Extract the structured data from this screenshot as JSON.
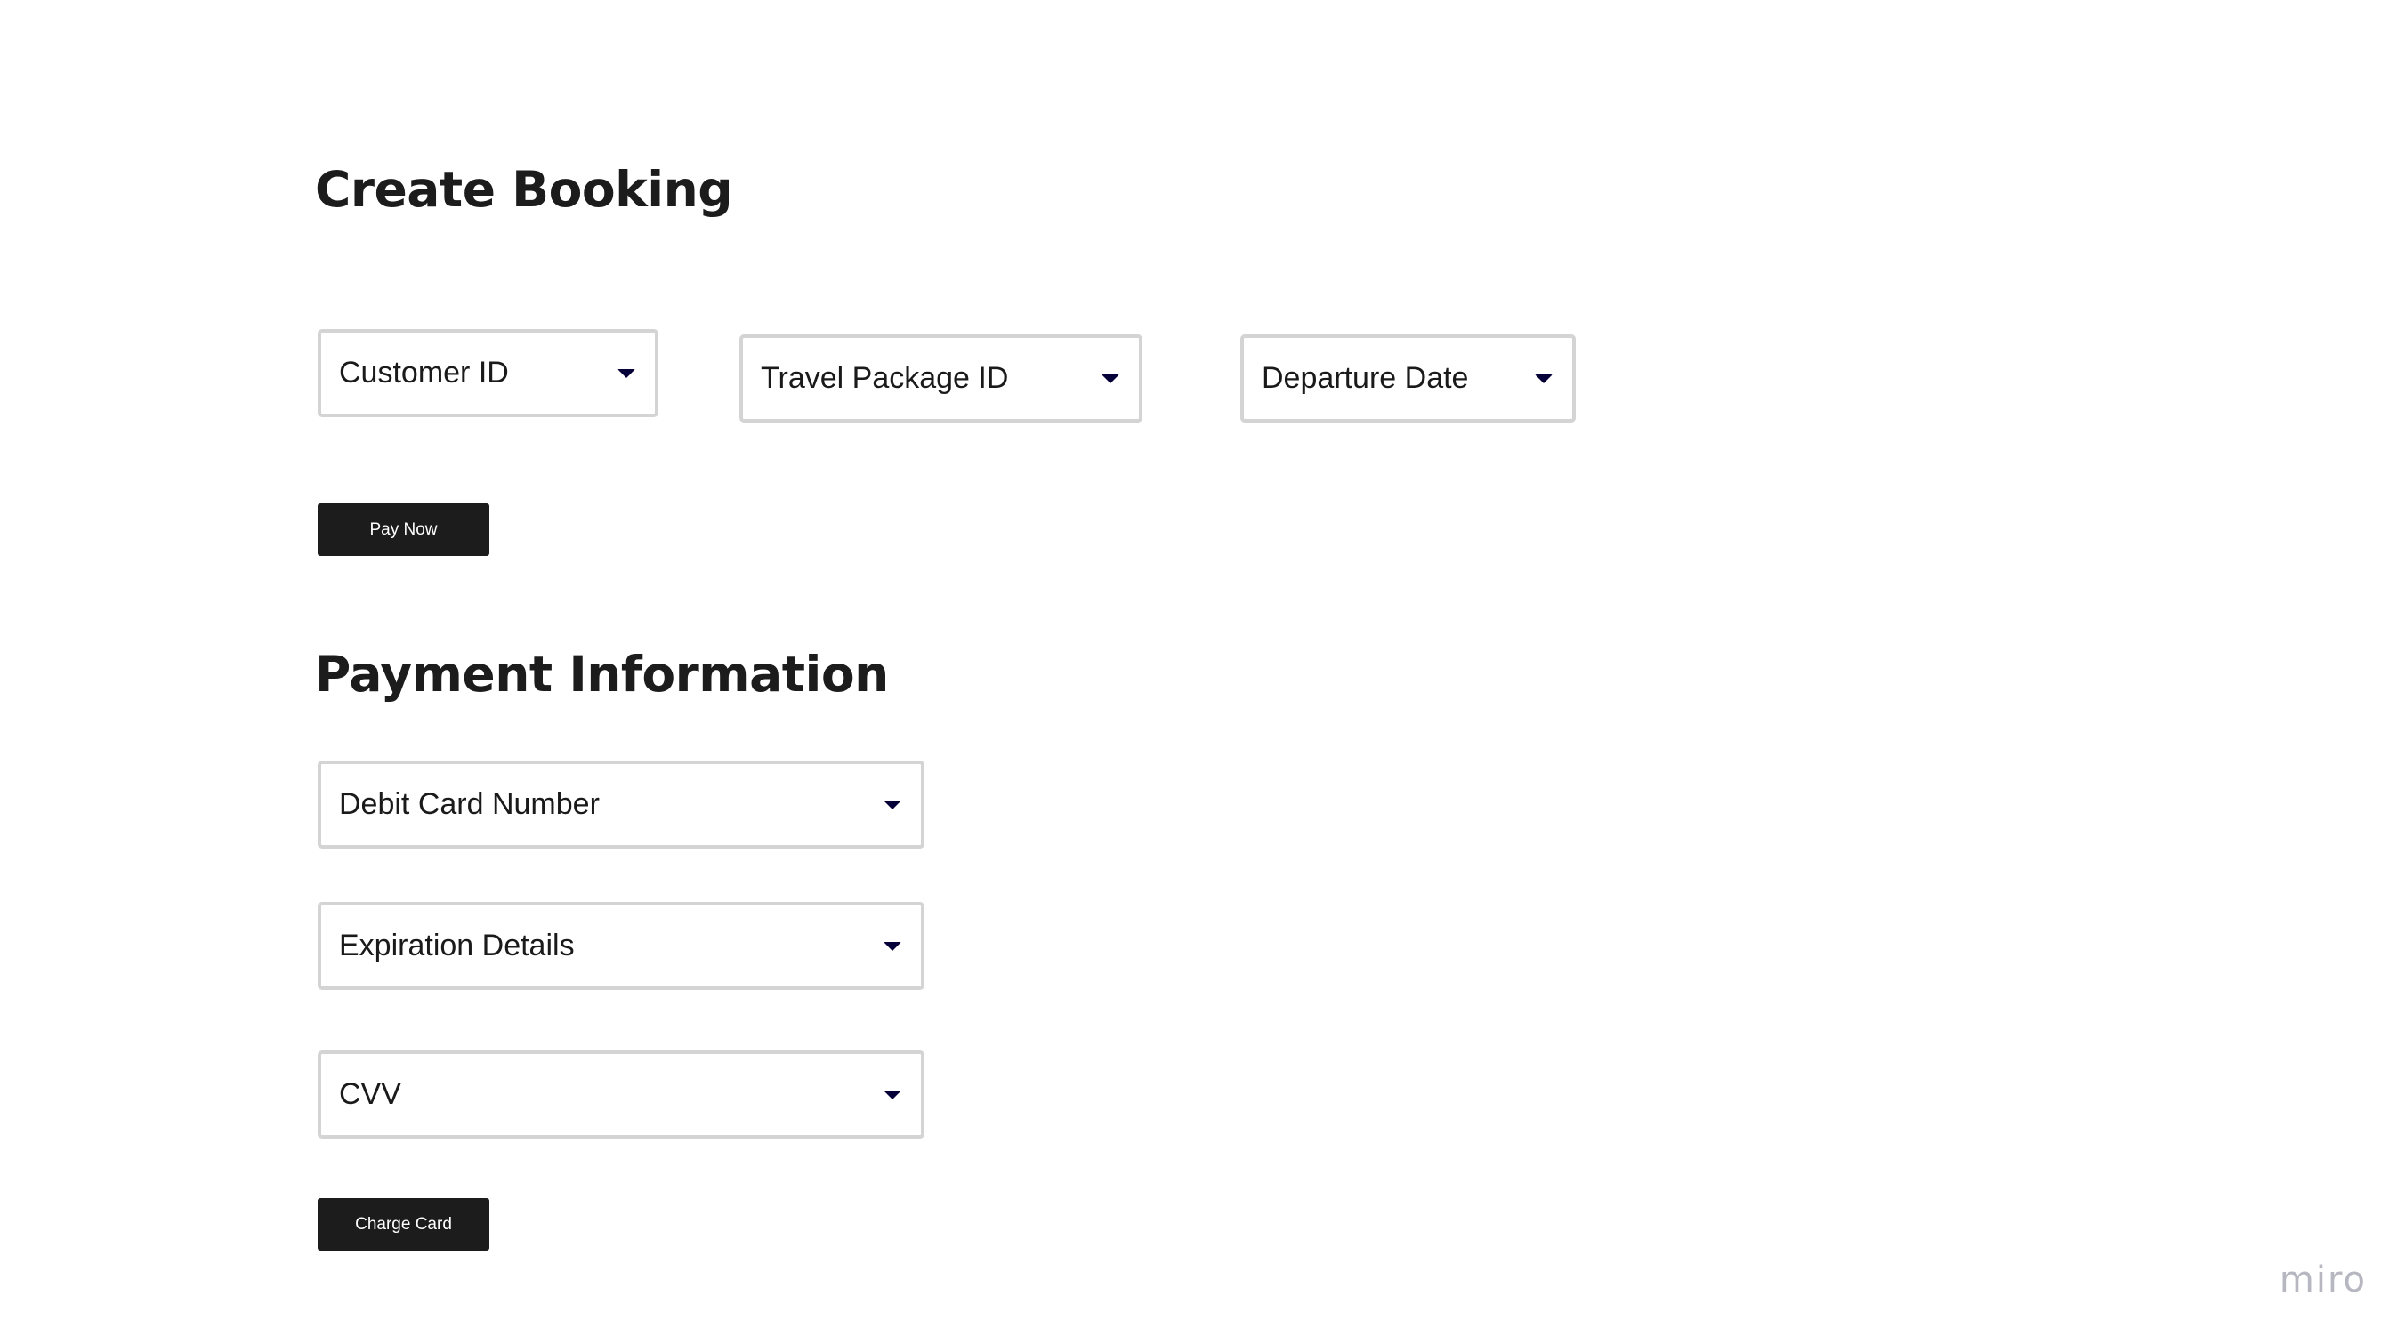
{
  "booking": {
    "title": "Create Booking",
    "customer_id_label": "Customer ID",
    "travel_package_id_label": "Travel Package ID",
    "departure_date_label": "Departure Date",
    "pay_now_label": "Pay Now"
  },
  "payment": {
    "title": "Payment Information",
    "debit_card_number_label": "Debit Card Number",
    "expiration_details_label": "Expiration Details",
    "cvv_label": "CVV",
    "charge_card_label": "Charge Card"
  },
  "watermark": "miro",
  "icons": {
    "dropdown": "chevron-down-icon"
  },
  "colors": {
    "heading": "#1c1c1c",
    "button_bg": "#1c1c1c",
    "button_text": "#ffffff",
    "field_border": "#d4d4d4",
    "caret": "#050038",
    "watermark": "#b7b7c2"
  }
}
